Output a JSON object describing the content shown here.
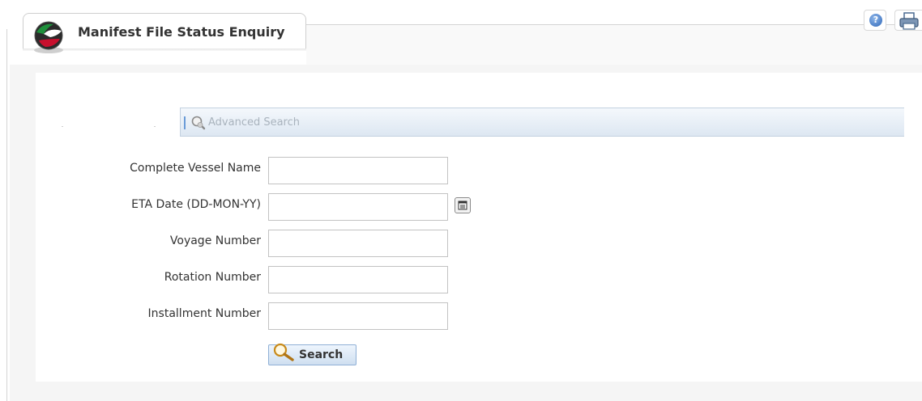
{
  "header": {
    "title": "Manifest File Status Enquiry"
  },
  "toolbar": {
    "help_icon": "help-icon",
    "help_glyph": "?",
    "print_icon": "print-icon"
  },
  "advanced_search": {
    "label": "Advanced Search",
    "icon": "magnifier-icon"
  },
  "form": {
    "vessel_name_label": "Complete Vessel Name",
    "vessel_name_value": "",
    "eta_date_label": "ETA Date (DD-MON-YY)",
    "eta_date_value": "",
    "voyage_number_label": "Voyage Number",
    "voyage_number_value": "",
    "rotation_number_label": "Rotation Number",
    "rotation_number_value": "",
    "installment_number_label": "Installment Number",
    "installment_number_value": "",
    "calendar_icon": "calendar-icon",
    "search_label": "Search"
  },
  "colors": {
    "accent_blue": "#2f67b8",
    "bar_gradient_top": "#f4f8fc",
    "bar_gradient_bottom": "#dde7f2"
  }
}
